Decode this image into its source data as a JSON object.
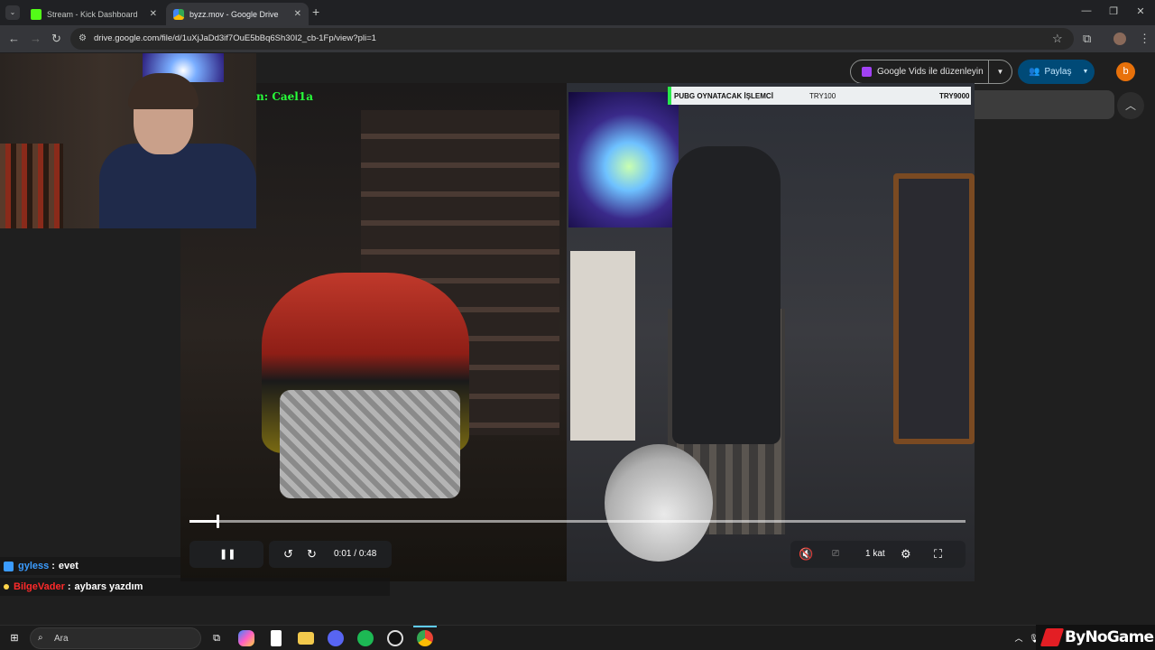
{
  "browser": {
    "tabs": [
      {
        "title": "Stream - Kick Dashboard",
        "favicon_color": "#53fc18",
        "active": false
      },
      {
        "title": "byzz.mov - Google Drive",
        "favicon_color": "#34a853",
        "active": true
      }
    ],
    "url": "drive.google.com/file/d/1uXjJaDd3if7OuE5bBq6Sh30I2_cb-1Fp/view?pli=1"
  },
  "drive": {
    "edit_button_label": "Google Vids ile düzenleyin",
    "share_button_label": "Paylaş",
    "avatar_letter": "b"
  },
  "video_overlay": {
    "name_text": "n: Cael1a",
    "goal_label": "PUBG OYNATACAK İŞLEMCİ",
    "goal_current": "TRY100",
    "goal_target": "TRY9000"
  },
  "player": {
    "current_time": "0:01",
    "separator": "/",
    "duration": "0:48",
    "progress_fraction": 0.035,
    "speed_label": "1 kat",
    "muted": true
  },
  "chat": [
    {
      "user": "gyless",
      "user_color": "#3b9cff",
      "message": "evet",
      "badge_color": "#3b9cff"
    },
    {
      "user": "BilgeVader",
      "user_color": "#ff2a2a",
      "message": "aybars yazdım",
      "badge_color": "#ffd54a"
    }
  ],
  "taskbar": {
    "search_placeholder": "Ara"
  },
  "watermark": {
    "text": "ByNoGame"
  },
  "colors": {
    "accent_blue": "#004a77",
    "overlay_green": "#27ff3a"
  }
}
